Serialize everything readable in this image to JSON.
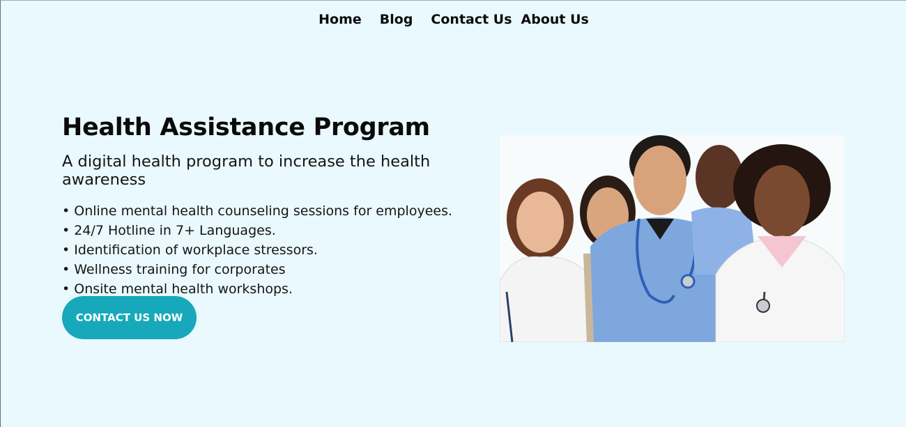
{
  "nav": {
    "items": [
      {
        "label": "Home"
      },
      {
        "label": "Blog"
      },
      {
        "label": "Contact Us"
      },
      {
        "label": "About Us"
      }
    ]
  },
  "hero": {
    "title": "Health Assistance Program",
    "subtitle": "A digital health program to increase the health awareness",
    "features": [
      "Online mental health counseling sessions for employees.",
      "24/7 Hotline in 7+ Languages.",
      "Identification of workplace stressors.",
      "Wellness training for corporates",
      "Onsite mental health workshops."
    ],
    "cta_label": "CONTACT US NOW"
  },
  "colors": {
    "background": "#e9f9fd",
    "cta": "#17a9bb"
  }
}
